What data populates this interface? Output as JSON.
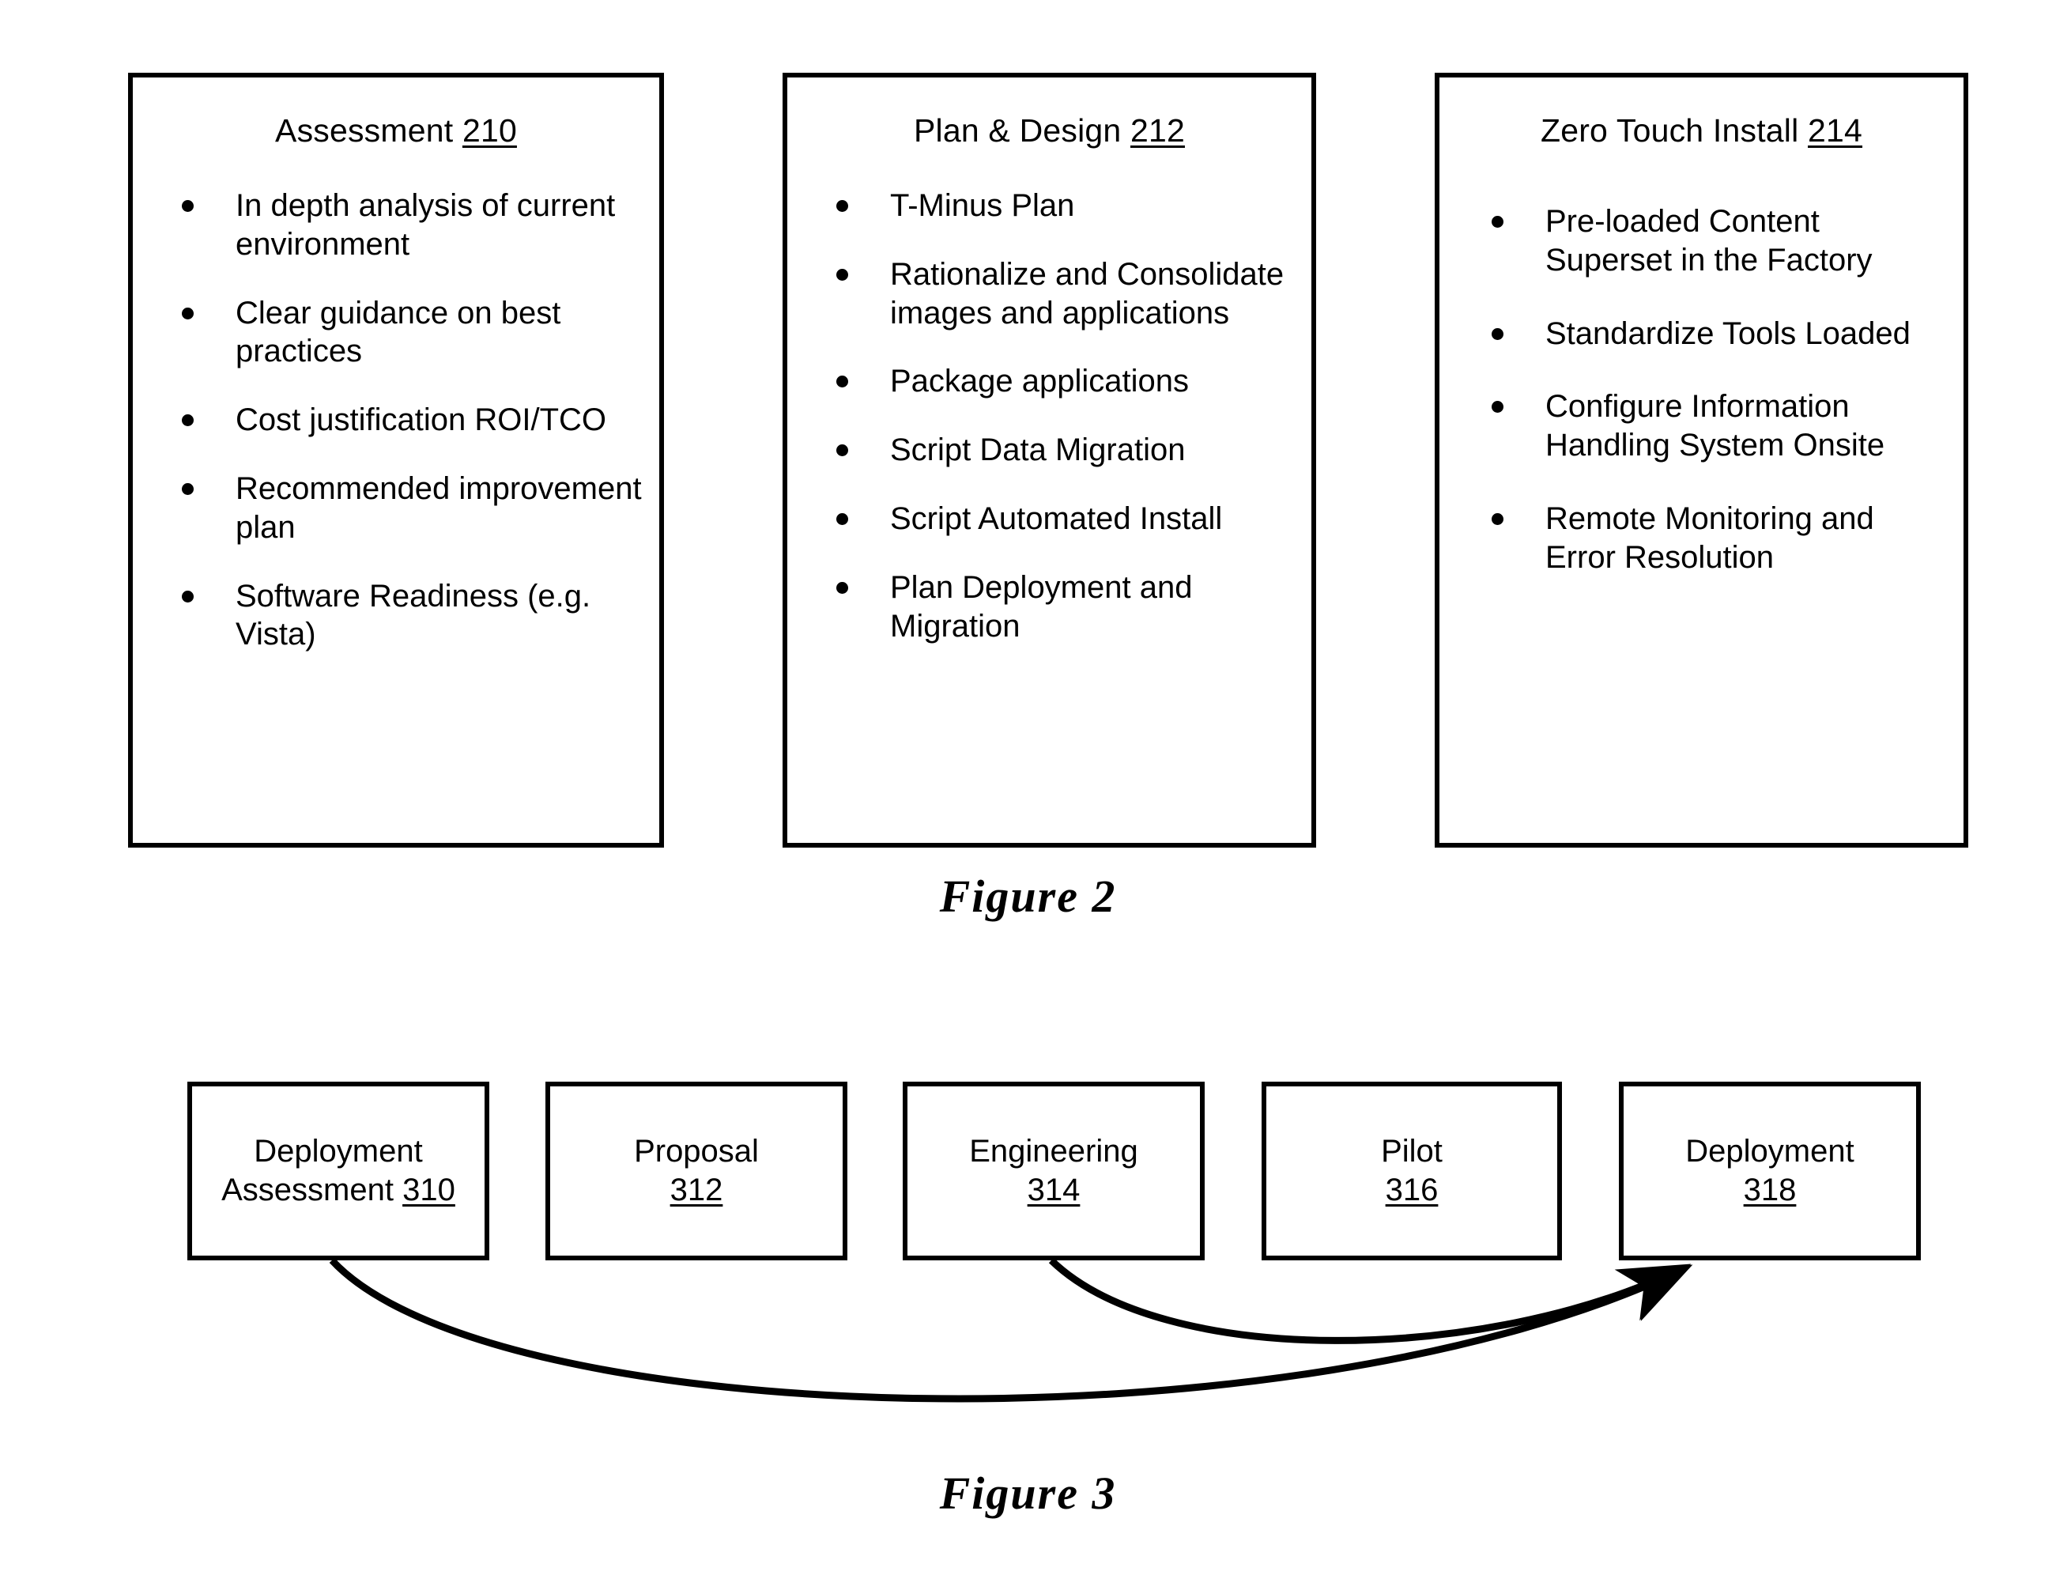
{
  "figure2": {
    "caption": "Figure 2",
    "boxes": [
      {
        "title": "Assessment",
        "ref": "210",
        "bullets": [
          "In depth analysis of current environment",
          "Clear guidance on best practices",
          "Cost justification ROI/TCO",
          "Recommended improvement plan",
          "Software Readiness (e.g. Vista)"
        ]
      },
      {
        "title": "Plan & Design",
        "ref": "212",
        "bullets": [
          "T-Minus Plan",
          "Rationalize and Consolidate images and applications",
          "Package applications",
          "Script Data Migration",
          "Script Automated Install",
          "Plan Deployment and Migration"
        ]
      },
      {
        "title": "Zero Touch Install",
        "ref": "214",
        "bullets": [
          "Pre-loaded Content Superset in the Factory",
          "Standardize Tools Loaded",
          "Configure Information Handling System Onsite",
          "Remote Monitoring and Error Resolution"
        ]
      }
    ]
  },
  "figure3": {
    "caption": "Figure 3",
    "boxes": [
      {
        "line1": "Deployment",
        "line2": "Assessment",
        "ref": "310"
      },
      {
        "line1": "Proposal",
        "line2": "",
        "ref": "312"
      },
      {
        "line1": "Engineering",
        "line2": "",
        "ref": "314"
      },
      {
        "line1": "Pilot",
        "line2": "",
        "ref": "316"
      },
      {
        "line1": "Deployment",
        "line2": "",
        "ref": "318"
      }
    ],
    "connectors": [
      {
        "from": "Deployment Assessment 310",
        "to": "Deployment 318",
        "style": "curved-arrow"
      },
      {
        "from": "Engineering 314",
        "to": "Deployment 318",
        "style": "curved-arrow"
      }
    ]
  },
  "colors": {
    "stroke": "#000000",
    "background": "#ffffff"
  }
}
